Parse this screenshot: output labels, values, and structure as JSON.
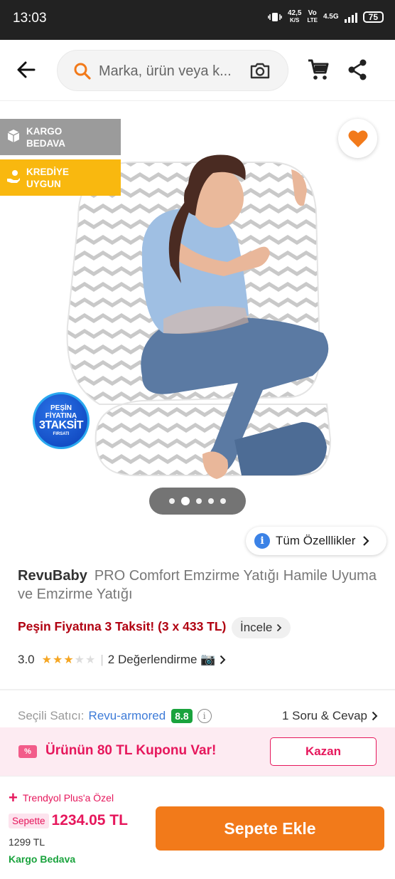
{
  "status_bar": {
    "time": "13:03",
    "speed_value": "42,5",
    "speed_unit": "K/S",
    "vo": "Vo",
    "lte": "LTE",
    "network": "4.5G",
    "battery": "75"
  },
  "header": {
    "search_placeholder": "Marka, ürün veya k...",
    "icons": [
      "back-arrow-icon",
      "search-icon",
      "camera-icon",
      "cart-icon",
      "share-icon"
    ]
  },
  "badges": [
    {
      "line1": "KARGO",
      "line2": "BEDAVA",
      "color": "#9b9b9b"
    },
    {
      "line1": "KREDİYE",
      "line2": "UYGUN",
      "color": "#f9b80f"
    }
  ],
  "promo_sticker": {
    "line1": "PEŞİN",
    "line2": "FİYATINA",
    "line3": "3TAKSİT",
    "line4": "FIRSATI"
  },
  "gallery": {
    "count": 5,
    "active_index": 1
  },
  "features_button": "Tüm Özelllikler",
  "product": {
    "brand": "RevuBaby",
    "name": "PRO Comfort Emzirme Yatığı Hamile Uyuma ve Emzirme Yatığı"
  },
  "installment": {
    "text": "Peşin Fiyatına 3 Taksit! (3 x 433 TL)",
    "button": "İncele"
  },
  "rating": {
    "score": "3.0",
    "stars": 3,
    "max_stars": 5,
    "reviews": "2 Değerlendirme 📷"
  },
  "seller": {
    "label": "Seçili Satıcı:",
    "name": "Revu-armored",
    "score": "8.8",
    "qa": "1 Soru & Cevap"
  },
  "coupon": {
    "icon_text": "%",
    "text": "Ürünün 80 TL Kuponu Var!",
    "button": "Kazan"
  },
  "footer": {
    "plus_label": "Trendyol Plus'a Özel",
    "basket_label": "Sepette",
    "basket_price": "1234.05 TL",
    "old_price": "1299 TL",
    "shipping": "Kargo Bedava",
    "add_button": "Sepete Ekle"
  },
  "colors": {
    "brand_orange": "#f27a1a",
    "pink": "#e6175c",
    "green": "#1aa33d",
    "star": "#f5a623"
  }
}
